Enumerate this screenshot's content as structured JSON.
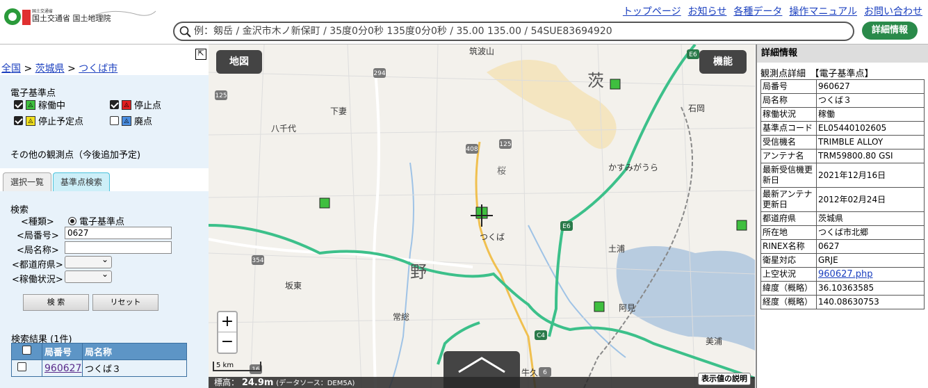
{
  "header": {
    "links": [
      "トップページ",
      "お知らせ",
      "各種データ",
      "操作マニュアル",
      "お問い合わせ"
    ],
    "search_placeholder": "例：剱岳 / 金沢市木ノ新保町 / 35度0分0秒 135度0分0秒 / 35.00 135.00 / 54SUE83694920",
    "detail_button": "詳細情報",
    "logo_text": "国土交通省 国土地理院"
  },
  "left": {
    "breadcrumb": [
      "全国",
      "茨城県",
      "つくば市"
    ],
    "breadcrumb_sep": ">",
    "legend_title": "電子基準点",
    "legend_items": [
      {
        "label": "稼働中",
        "checked": true,
        "color": "#3fbf3f"
      },
      {
        "label": "停止点",
        "checked": true,
        "color": "#e02020"
      },
      {
        "label": "停止予定点",
        "checked": true,
        "color": "#f0e020"
      },
      {
        "label": "廃点",
        "checked": false,
        "color": "#4a8de0"
      }
    ],
    "other_points": "その他の観測点（今後追加予定)",
    "tabs": [
      "選択一覧",
      "基準点検索"
    ],
    "search": {
      "title": "検索",
      "type_label": "<種類>",
      "type_value": "電子基準点",
      "station_no_label": "<局番号>",
      "station_no_value": "0627",
      "station_name_label": "<局名称>",
      "station_name_value": "",
      "pref_label": "<都道府県>",
      "status_label": "<稼働状況>",
      "search_button": "検 索",
      "reset_button": "リセット"
    },
    "results": {
      "title": "検索結果 (1件)",
      "headers": [
        "局番号",
        "局名称"
      ],
      "rows": [
        {
          "no": "960627",
          "name": "つくば３"
        }
      ]
    }
  },
  "map": {
    "map_button": "地図",
    "func_button": "機能",
    "zoom_in": "+",
    "zoom_out": "−",
    "scale": "5 km",
    "elevation_label": "標高：",
    "elevation_value": "24.9m",
    "elevation_source": "(データソース：DEM5A)",
    "explain_button": "表示値の説明",
    "place_labels": [
      "筑波山",
      "下妻",
      "八千代",
      "石岡",
      "かすみがうら",
      "つくば",
      "土浦",
      "坂東",
      "常総",
      "阿見",
      "美浦",
      "牛久",
      "茨",
      "桜",
      "野"
    ],
    "road_labels": [
      "294",
      "125",
      "408",
      "125",
      "354",
      "E6",
      "E6",
      "C4",
      "16",
      "6"
    ]
  },
  "right": {
    "header": "詳細情報",
    "title": "観測点詳細　【電子基準点】",
    "rows": [
      {
        "k": "局番号",
        "v": "960627"
      },
      {
        "k": "局名称",
        "v": "つくば３"
      },
      {
        "k": "稼働状況",
        "v": "稼働"
      },
      {
        "k": "基準点コード",
        "v": "EL05440102605"
      },
      {
        "k": "受信機名",
        "v": "TRIMBLE ALLOY"
      },
      {
        "k": "アンテナ名",
        "v": "TRM59800.80 GSI"
      },
      {
        "k": "最新受信機更新日",
        "v": "2021年12月16日"
      },
      {
        "k": "最新アンテナ更新日",
        "v": "2012年02月24日"
      },
      {
        "k": "都道府県",
        "v": "茨城県"
      },
      {
        "k": "所在地",
        "v": "つくば市北郷"
      },
      {
        "k": "RINEX名称",
        "v": "0627"
      },
      {
        "k": "衛星対応",
        "v": "GRJE"
      },
      {
        "k": "上空状況",
        "v": "960627.php",
        "link": true
      },
      {
        "k": "緯度（概略）",
        "v": "36.10363585"
      },
      {
        "k": "経度（概略）",
        "v": "140.08630753"
      }
    ]
  }
}
